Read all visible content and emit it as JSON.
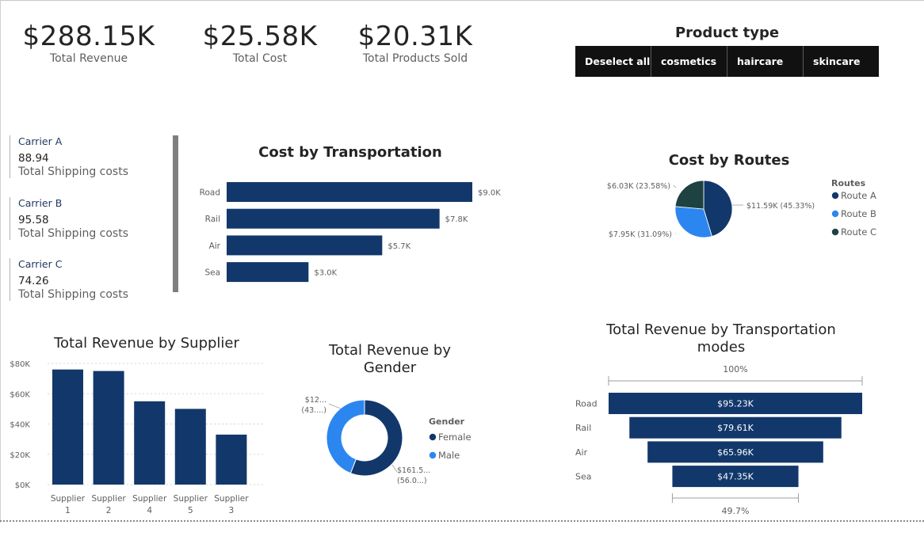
{
  "kpis": [
    {
      "value": "$288.15K",
      "label": "Total Revenue"
    },
    {
      "value": "$25.58K",
      "label": "Total Cost"
    },
    {
      "value": "$20.31K",
      "label": "Total Products Sold"
    }
  ],
  "slicer": {
    "title": "Product type",
    "options": [
      "Deselect all",
      "cosmetics",
      "haircare",
      "skincare"
    ]
  },
  "carriers": [
    {
      "name": "Carrier A",
      "value": "88.94",
      "label": "Total Shipping costs"
    },
    {
      "name": "Carrier B",
      "value": "95.58",
      "label": "Total Shipping costs"
    },
    {
      "name": "Carrier C",
      "value": "74.26",
      "label": "Total Shipping costs"
    }
  ],
  "colors": {
    "navy": "#12386b",
    "blue": "#2b86f0",
    "dark_green": "#1e4141"
  },
  "chart_data": [
    {
      "id": "cost_transport",
      "type": "bar",
      "orientation": "horizontal",
      "title": "Cost by Transportation",
      "categories": [
        "Road",
        "Rail",
        "Air",
        "Sea"
      ],
      "values": [
        9.0,
        7.8,
        5.7,
        3.0
      ],
      "labels": [
        "$9.0K",
        "$7.8K",
        "$5.7K",
        "$3.0K"
      ],
      "xlim": [
        0,
        9.0
      ]
    },
    {
      "id": "cost_routes",
      "type": "pie",
      "title": "Cost by Routes",
      "legend_title": "Routes",
      "legend_position": "right",
      "categories": [
        "Route A",
        "Route B",
        "Route C"
      ],
      "values": [
        11.59,
        7.95,
        6.03
      ],
      "percents": [
        45.33,
        31.09,
        23.58
      ],
      "labels": [
        "$11.59K (45.33%)",
        "$7.95K (31.09%)",
        "$6.03K (23.58%)"
      ],
      "colors": [
        "#12386b",
        "#2b86f0",
        "#1e4141"
      ]
    },
    {
      "id": "rev_supplier",
      "type": "bar",
      "title": "Total Revenue by Supplier",
      "categories": [
        [
          "Supplier",
          "1"
        ],
        [
          "Supplier",
          "2"
        ],
        [
          "Supplier",
          "4"
        ],
        [
          "Supplier",
          "5"
        ],
        [
          "Supplier",
          "3"
        ]
      ],
      "values": [
        76,
        75,
        55,
        50,
        33
      ],
      "yticks": [
        "$0K",
        "$20K",
        "$40K",
        "$60K",
        "$80K"
      ],
      "ylim": [
        0,
        80
      ],
      "grid": true
    },
    {
      "id": "rev_gender",
      "type": "pie",
      "subtype": "donut",
      "title": "Total Revenue by Gender",
      "legend_title": "Gender",
      "legend_position": "right",
      "categories": [
        "Female",
        "Male"
      ],
      "values": [
        56.0,
        44.0
      ],
      "labels": [
        [
          "$161.5...",
          "(56.0...)"
        ],
        [
          "$12...",
          "(43....)"
        ]
      ],
      "colors": [
        "#12386b",
        "#2b86f0"
      ]
    },
    {
      "id": "rev_transport_modes",
      "type": "bar",
      "subtype": "funnel",
      "title": "Total Revenue by Transportation modes",
      "categories": [
        "Road",
        "Rail",
        "Air",
        "Sea"
      ],
      "values": [
        95.23,
        79.61,
        65.96,
        47.35
      ],
      "labels": [
        "$95.23K",
        "$79.61K",
        "$65.96K",
        "$47.35K"
      ],
      "top_percent": "100%",
      "bottom_percent": "49.7%"
    }
  ]
}
